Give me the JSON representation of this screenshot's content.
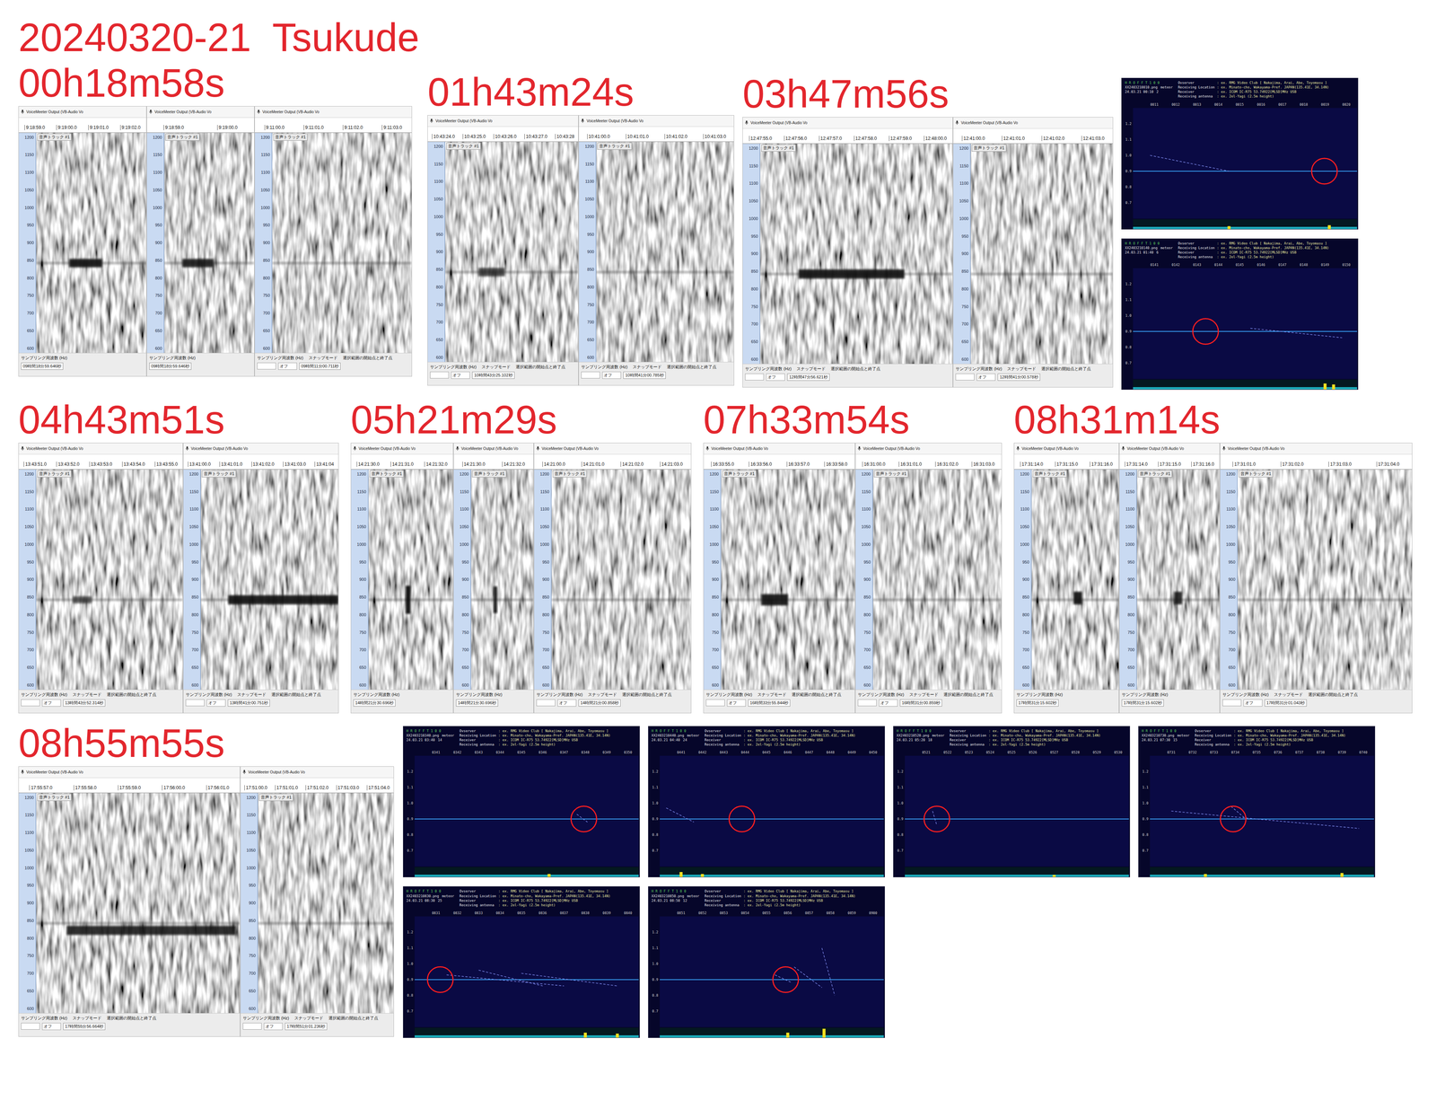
{
  "title": "20240320-21  Tsukude",
  "spectrogram": {
    "device": "VoiceMeeter Output (VB-Audio Vo",
    "track": "音声トラック #1",
    "carrier": 845,
    "axis": [
      "1200",
      "1150",
      "1100",
      "1050",
      "1000",
      "950",
      "900",
      "850",
      "800",
      "750",
      "700",
      "650",
      "600"
    ],
    "footer": {
      "rate": "サンプリング周波数 (Hz)",
      "snap": "スナップモード",
      "range": "選択範囲の開始点と終了点",
      "off": "オフ"
    }
  },
  "events": [
    {
      "time": "00h18m58s",
      "panels": [
        {
          "ticks": [
            "9:18:59.0",
            "9:19:00.0",
            "9:19:01.0",
            "9:19:02.0"
          ],
          "selection": "09時間18分59.646秒",
          "echo": {
            "start": 0.3,
            "end": 0.6,
            "freq": 845,
            "spread": 12,
            "strength": 0.9
          }
        },
        {
          "ticks": [
            "9:18:59.0",
            "9:19:00.0"
          ],
          "selection": "09時間18分59.646秒",
          "echo": {
            "start": 0.2,
            "end": 0.55,
            "freq": 845,
            "spread": 12,
            "strength": 0.85
          }
        },
        {
          "ticks": [
            "9:11:00.0",
            "9:11:01.0",
            "9:11:02.0",
            "9:11:03.0"
          ],
          "selection": "09時間11分00.711秒",
          "echo": null
        }
      ]
    },
    {
      "time": "01h43m24s",
      "panels": [
        {
          "ticks": [
            "10:43:24.0",
            "10:43:25.0",
            "10:43:26.0",
            "10:43:27.0",
            "10:43:28"
          ],
          "selection": "10時間43分25.102秒",
          "echo": {
            "start": 0.25,
            "end": 0.45,
            "freq": 845,
            "spread": 12,
            "strength": 0.7
          }
        },
        {
          "ticks": [
            "10:41:00.0",
            "10:41:01.0",
            "10:41:02.0",
            "10:41:03.0"
          ],
          "selection": "10時間41分00.785秒",
          "echo": null
        }
      ]
    },
    {
      "time": "03h47m56s",
      "panels": [
        {
          "ticks": [
            "12:47:55.0",
            "12:47:56.0",
            "12:47:57.0",
            "12:47:58.0",
            "12:47:59.0",
            "12:48:00.0"
          ],
          "selection": "12時間47分56.621秒",
          "echo": {
            "start": 0.2,
            "end": 0.75,
            "freq": 845,
            "spread": 13,
            "strength": 0.9
          }
        },
        {
          "ticks": [
            "12:41:00.0",
            "12:41:01.0",
            "12:41:02.0",
            "12:41:03.0"
          ],
          "selection": "12時間41分00.578秒",
          "echo": null
        }
      ]
    },
    {
      "time": "04h43m51s",
      "panels": [
        {
          "ticks": [
            "13:43:51.0",
            "13:43:52.0",
            "13:43:53.0",
            "13:43:54.0",
            "13:43:55.0"
          ],
          "selection": "13時間43分52.314秒",
          "echo": {
            "start": 0.25,
            "end": 0.38,
            "freq": 845,
            "spread": 10,
            "strength": 0.6
          }
        },
        {
          "ticks": [
            "13:41:00.0",
            "13:41:01.0",
            "13:41:02.0",
            "13:41:03.0",
            "13:41:04"
          ],
          "selection": "13時間41分00.751秒",
          "echo": {
            "start": 0.2,
            "end": 1.0,
            "freq": 845,
            "spread": 13,
            "strength": 0.9
          }
        }
      ]
    },
    {
      "time": "05h21m29s",
      "panels": [
        {
          "ticks": [
            "14:21:30.0",
            "14:21:31.0",
            "14:21:32.0"
          ],
          "selection": "14時間21分30.696秒",
          "echo": {
            "start": 0.44,
            "end": 0.5,
            "freq": 845,
            "spread": 40,
            "strength": 0.95
          }
        },
        {
          "ticks": [
            "14:21:30.0",
            "14:21:32.0"
          ],
          "selection": "14時間21分30.696秒",
          "echo": {
            "start": 0.36,
            "end": 0.42,
            "freq": 845,
            "spread": 38,
            "strength": 0.9
          }
        },
        {
          "ticks": [
            "14:21:00.0",
            "14:21:01.0",
            "14:21:02.0",
            "14:21:03.0"
          ],
          "selection": "14時間21分00.858秒",
          "echo": null
        }
      ]
    },
    {
      "time": "07h33m54s",
      "panels": [
        {
          "ticks": [
            "16:33:55.0",
            "16:33:56.0",
            "16:33:57.0",
            "16:33:58.0"
          ],
          "selection": "16時間33分55.844秒",
          "echo": {
            "start": 0.3,
            "end": 0.5,
            "freq": 845,
            "spread": 16,
            "strength": 0.9
          }
        },
        {
          "ticks": [
            "16:31:00.0",
            "16:31:01.0",
            "16:31:02.0",
            "16:31:03.0"
          ],
          "selection": "16時間31分00.859秒",
          "echo": null
        }
      ]
    },
    {
      "time": "08h31m14s",
      "panels": [
        {
          "ticks": [
            "17:31:14.0",
            "17:31:15.0",
            "17:31:16.0"
          ],
          "selection": "17時間31分15.602秒",
          "echo": {
            "start": 0.48,
            "end": 0.58,
            "freq": 850,
            "spread": 18,
            "strength": 0.9
          }
        },
        {
          "ticks": [
            "17:31:14.0",
            "17:31:15.0",
            "17:31:16.0"
          ],
          "selection": "17時間31分15.602秒",
          "echo": {
            "start": 0.45,
            "end": 0.55,
            "freq": 850,
            "spread": 18,
            "strength": 0.85
          }
        },
        {
          "ticks": [
            "17:31:01.0",
            "17:31:02.0",
            "17:31:03.0",
            "17:31:04.0"
          ],
          "selection": "17時間31分01.043秒",
          "echo": null
        }
      ]
    },
    {
      "time": "08h55m55s",
      "panels": [
        {
          "ticks": [
            "17:55:57.0",
            "17:55:58.0",
            "17:55:59.0",
            "17:56:00.0",
            "17:56:01.0"
          ],
          "selection": "17時間55分56.664秒",
          "echo": {
            "start": 0.15,
            "end": 0.98,
            "freq": 825,
            "spread": 13,
            "strength": 0.85
          }
        },
        {
          "ticks": [
            "17:51:00.0",
            "17:51:01.0",
            "17:51:02.0",
            "17:51:03.0",
            "17:51:04.0"
          ],
          "selection": "17時間51分01.236秒",
          "echo": null
        }
      ]
    }
  ],
  "hrofft": {
    "logo": "H R O F F T  1 0 0",
    "kind": "meteor",
    "carrier": 0.9,
    "yAxis": [
      "1.2",
      "1.1",
      "1.0",
      "0.9",
      "0.8",
      "0.7"
    ],
    "fields": [
      {
        "label": "Ovserver",
        "value": ": ex. RMG Video Club [ Nakajima, Arai, Abe, Toyomasu ]"
      },
      {
        "label": "Receiving Location",
        "value": ": ex. Minato-cho, Wakayama-Pref. JAPAN(135.41E, 34.14N)"
      },
      {
        "label": "Receiver",
        "value": ": ex. ICOM IC-R75 53.74922[MLSD]MHz USB"
      },
      {
        "label": "Receiving antenna",
        "value": ": ex. 2el-Yagi (2.5m height)"
      }
    ],
    "images": [
      {
        "file": "XX2403210010.png",
        "date": "24.03.21 00:10",
        "count": "2",
        "ticks": [
          "0011",
          "0012",
          "0013",
          "0014",
          "0015",
          "0016",
          "0017",
          "0018",
          "0019",
          "0020"
        ],
        "marker": 8.97,
        "traces": [
          [
            0.8,
            1.0,
            4.5,
            0.9
          ]
        ],
        "spikes": [
          [
            4.5,
            0.3
          ],
          [
            9.2,
            0.4
          ]
        ]
      },
      {
        "file": "XX2403210140.png",
        "date": "24.03.21 01:40",
        "count": "6",
        "ticks": [
          "0141",
          "0142",
          "0143",
          "0144",
          "0145",
          "0146",
          "0147",
          "0148",
          "0149",
          "0150"
        ],
        "marker": 3.4,
        "traces": [
          [
            5.5,
            0.92,
            9.8,
            0.86
          ]
        ],
        "spikes": [
          [
            9.0,
            0.6
          ],
          [
            9.4,
            0.5
          ]
        ]
      },
      {
        "file": "XX2403210340.png",
        "date": "24.03.21 03:40",
        "count": "14",
        "ticks": [
          "0341",
          "0342",
          "0343",
          "0344",
          "0345",
          "0346",
          "0347",
          "0348",
          "0349",
          "0350"
        ],
        "marker": 7.93,
        "traces": [
          [
            7.6,
            0.93,
            8.1,
            0.88
          ]
        ],
        "spikes": [
          [
            6.3,
            0.3
          ]
        ]
      },
      {
        "file": "XX2403210440.png",
        "date": "24.03.21 04:40",
        "count": "24",
        "ticks": [
          "0441",
          "0442",
          "0443",
          "0444",
          "0445",
          "0446",
          "0447",
          "0448",
          "0449",
          "0450"
        ],
        "marker": 3.85,
        "traces": [
          [
            0.3,
            0.97,
            1.6,
            0.88
          ]
        ],
        "spikes": [
          [
            1.0,
            0.5
          ],
          [
            2.0,
            0.3
          ]
        ]
      },
      {
        "file": "XX2403210520.png",
        "date": "24.03.21 05:20",
        "count": "18",
        "ticks": [
          "0521",
          "0522",
          "0523",
          "0524",
          "0525",
          "0526",
          "0527",
          "0528",
          "0529",
          "0530"
        ],
        "marker": 1.5,
        "traces": [
          [
            1.3,
            0.95,
            1.5,
            0.86
          ]
        ],
        "spikes": [
          [
            7.0,
            0.2
          ]
        ]
      },
      {
        "file": "XX2403210730.png",
        "date": "24.03.21 07:30",
        "count": "15",
        "ticks": [
          "0731",
          "0732",
          "0733",
          "0734",
          "0735",
          "0736",
          "0737",
          "0738",
          "0739",
          "0740"
        ],
        "marker": 3.9,
        "traces": [
          [
            1.0,
            0.95,
            9.8,
            0.84
          ],
          [
            3.8,
            0.98,
            4.5,
            0.9
          ]
        ],
        "spikes": [
          [
            2.6,
            0.3
          ],
          [
            9.0,
            0.4
          ]
        ]
      },
      {
        "file": "XX2403210830.png",
        "date": "24.03.21 08:30",
        "count": "25",
        "ticks": [
          "0831",
          "0832",
          "0833",
          "0834",
          "0835",
          "0836",
          "0837",
          "0838",
          "0839",
          "0840"
        ],
        "marker": 1.2,
        "traces": [
          [
            1.5,
            0.93,
            7.0,
            0.86
          ],
          [
            3.0,
            0.96,
            6.0,
            0.86
          ],
          [
            5.0,
            0.94,
            9.5,
            0.86
          ]
        ],
        "spikes": [
          [
            8.0,
            0.5
          ],
          [
            9.5,
            0.4
          ]
        ]
      },
      {
        "file": "XX2403210850.png",
        "date": "24.03.21 08:50",
        "count": "12",
        "ticks": [
          "0851",
          "0852",
          "0853",
          "0854",
          "0855",
          "0856",
          "0857",
          "0858",
          "0859",
          "0900"
        ],
        "marker": 5.9,
        "traces": [
          [
            6.3,
            0.98,
            7.6,
            0.85
          ],
          [
            7.6,
            1.1,
            8.2,
            0.8
          ],
          [
            5.4,
            0.93,
            6.2,
            0.88
          ]
        ],
        "spikes": [
          [
            6.0,
            0.5
          ],
          [
            7.7,
            0.9
          ]
        ]
      }
    ]
  }
}
